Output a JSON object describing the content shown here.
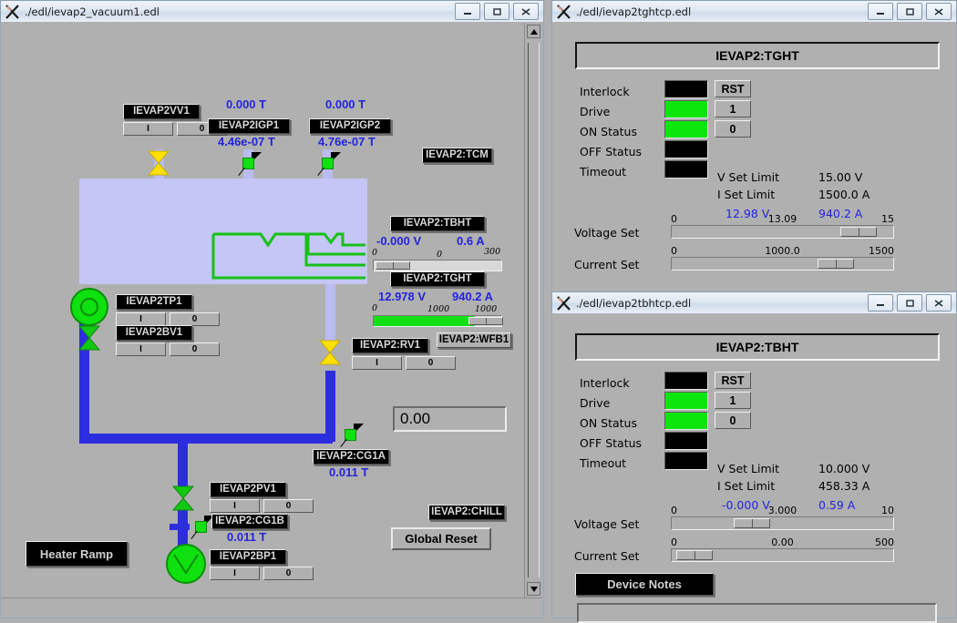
{
  "windows": {
    "vacuum": {
      "title": "./edl/ievap2_vacuum1.edl"
    },
    "tght": {
      "title": "./edl/ievap2tghtcp.edl"
    },
    "tbht": {
      "title": "./edl/ievap2tbhtcp.edl"
    }
  },
  "titlebar_buttons": {
    "minimize": "minimize-icon",
    "maximize": "maximize-icon",
    "close": "close-icon"
  },
  "vacuum": {
    "devices": [
      {
        "name": "IEVAP2VV1",
        "on": "I",
        "off": "0"
      },
      {
        "name": "IEVAP2TP1",
        "on": "I",
        "off": "0"
      },
      {
        "name": "IEVAP2BV1",
        "on": "I",
        "off": "0"
      },
      {
        "name": "IEVAP2:RV1",
        "on": "I",
        "off": "0"
      },
      {
        "name": "IEVAP2PV1",
        "on": "I",
        "off": "0"
      },
      {
        "name": "IEVAP2BP1",
        "on": "I",
        "off": "0"
      }
    ],
    "gauges": [
      {
        "name": "IEVAP2IGP1",
        "top": "0.000 T",
        "bottom": "4.46e-07 T"
      },
      {
        "name": "IEVAP2IGP2",
        "top": "0.000 T",
        "bottom": "4.76e-07 T"
      },
      {
        "name": "IEVAP2:CG1A",
        "value": "0.011 T"
      },
      {
        "name": "IEVAP2:CG1B",
        "value": "0.011 T"
      }
    ],
    "labels": {
      "tcm": "IEVAP2:TCM",
      "wfb1": "IEVAP2:WFB1",
      "chill": "IEVAP2:CHILL",
      "tbht": "IEVAP2:TBHT",
      "tght": "IEVAP2:TGHT"
    },
    "heaters": [
      {
        "name": "IEVAP2:TBHT",
        "voltage": "-0.000 V",
        "current": "0.6 A",
        "tick_min": "0",
        "tick_mid": "0",
        "tick_max": "300",
        "fill_pct": 0,
        "knob_pct": 2
      },
      {
        "name": "IEVAP2:TGHT",
        "voltage": "12.978 V",
        "current": "940.2 A",
        "tick_min": "0",
        "tick_mid": "1000",
        "tick_max": "1000",
        "fill_pct": 79,
        "knob_pct": 79
      }
    ],
    "buttons": {
      "heater_ramp": "Heater Ramp",
      "global_reset": "Global Reset"
    },
    "numeric_entry": "0.00"
  },
  "controlpanels": [
    {
      "key": "tght",
      "header": "IEVAP2:TGHT",
      "status_rows": [
        {
          "label": "Interlock",
          "state": "off"
        },
        {
          "label": "Drive",
          "state": "on"
        },
        {
          "label": "ON Status",
          "state": "on"
        },
        {
          "label": "OFF Status",
          "state": "off"
        },
        {
          "label": "Timeout",
          "state": "off"
        }
      ],
      "side_buttons": [
        "RST",
        "1",
        "0"
      ],
      "limits": [
        {
          "label": "V Set Limit",
          "value": "15.00 V",
          "blue": false
        },
        {
          "label": "I Set Limit",
          "value": "1500.0 A",
          "blue": false
        }
      ],
      "readback": {
        "voltage": "12.98 V",
        "current": "940.2 A"
      },
      "sliders": [
        {
          "label": "Voltage Set",
          "min": "0",
          "value": "13.09",
          "max": "15",
          "pos_pct": 76
        },
        {
          "label": "Current Set",
          "min": "0",
          "value": "1000.0",
          "max": "1500",
          "pos_pct": 66
        }
      ],
      "device_notes": null
    },
    {
      "key": "tbht",
      "header": "IEVAP2:TBHT",
      "status_rows": [
        {
          "label": "Interlock",
          "state": "off"
        },
        {
          "label": "Drive",
          "state": "on"
        },
        {
          "label": "ON Status",
          "state": "on"
        },
        {
          "label": "OFF Status",
          "state": "off"
        },
        {
          "label": "Timeout",
          "state": "off"
        }
      ],
      "side_buttons": [
        "RST",
        "1",
        "0"
      ],
      "limits": [
        {
          "label": "V Set Limit",
          "value": "10.000 V",
          "blue": false
        },
        {
          "label": "I Set Limit",
          "value": "458.33 A",
          "blue": false
        }
      ],
      "readback": {
        "voltage": "-0.000 V",
        "current": "0.59 A"
      },
      "sliders": [
        {
          "label": "Voltage Set",
          "min": "0",
          "value": "3.000",
          "max": "10",
          "pos_pct": 28
        },
        {
          "label": "Current Set",
          "min": "0",
          "value": "0.00",
          "max": "500",
          "pos_pct": 2
        }
      ],
      "device_notes": "Device Notes"
    }
  ],
  "colors": {
    "lamp_on": "#0de60d",
    "lamp_off": "#000000",
    "readout_blue": "#2323e0",
    "pipe_blue": "#2d2de0",
    "chamber": "#c4c6f5",
    "panel_grey": "#b0b0b0"
  }
}
